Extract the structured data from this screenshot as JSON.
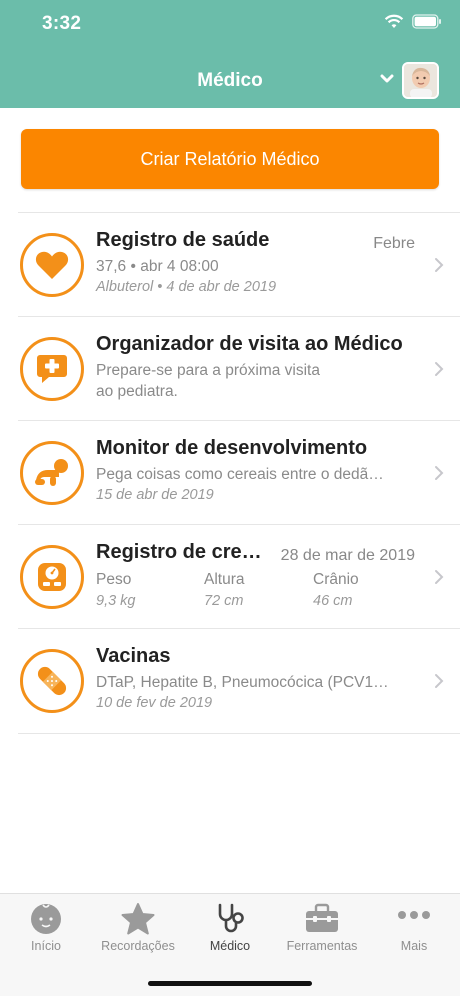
{
  "status": {
    "time": "3:32"
  },
  "header": {
    "title": "Médico"
  },
  "cta": {
    "label": "Criar Relatório Médico"
  },
  "rows": [
    {
      "title": "Registro de saúde",
      "right": "Febre",
      "line1": "37,6 • abr 4 08:00",
      "line2": "Albuterol • 4 de abr de 2019"
    },
    {
      "title": "Organizador de visita ao Médico",
      "line1": "Prepare-se para a próxima visita",
      "line2": "ao pediatra."
    },
    {
      "title": "Monitor de desenvolvimento",
      "line1": "Pega coisas como cereais entre o dedã…",
      "line2": "15 de abr de 2019"
    },
    {
      "title": "Registro de cre…",
      "right": "28 de mar de 2019",
      "cols": [
        {
          "h": "Peso",
          "v": "9,3 kg"
        },
        {
          "h": "Altura",
          "v": "72 cm"
        },
        {
          "h": "Crânio",
          "v": "46 cm"
        }
      ]
    },
    {
      "title": "Vacinas",
      "line1": "DTaP, Hepatite B, Pneumocócica (PCV1…",
      "line2": "10 de fev de 2019"
    }
  ],
  "tabs": [
    {
      "label": "Início",
      "icon": "baby-face-icon"
    },
    {
      "label": "Recordações",
      "icon": "star-icon"
    },
    {
      "label": "Médico",
      "icon": "stethoscope-icon"
    },
    {
      "label": "Ferramentas",
      "icon": "toolbox-icon"
    },
    {
      "label": "Mais",
      "icon": "more-dots-icon"
    }
  ],
  "colors": {
    "header": "#6bbdaa",
    "accent": "#fb8600",
    "icon_orange": "#f39019"
  }
}
